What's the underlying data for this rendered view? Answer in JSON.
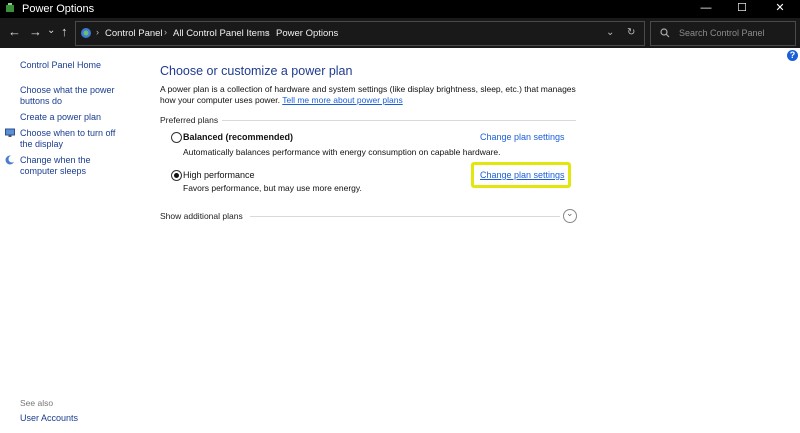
{
  "window": {
    "title": "Power Options",
    "minimize": "—",
    "maximize": "☐",
    "close": "✕"
  },
  "nav": {
    "back": "←",
    "forward": "→",
    "recent": "⌄",
    "up": "↑"
  },
  "address": {
    "crumbs": [
      "Control Panel",
      "All Control Panel Items",
      "Power Options"
    ],
    "separator": "›",
    "dropdown": "⌄",
    "refresh": "↻"
  },
  "search": {
    "placeholder": "Search Control Panel"
  },
  "help": "?",
  "sidebar": {
    "home": "Control Panel Home",
    "links": [
      "Choose what the power buttons do",
      "Create a power plan",
      "Choose when to turn off the display",
      "Change when the computer sleeps"
    ],
    "see_also": "See also",
    "user_accounts": "User Accounts"
  },
  "main": {
    "heading": "Choose or customize a power plan",
    "description": "A power plan is a collection of hardware and system settings (like display brightness, sleep, etc.) that manages how your computer uses power.",
    "tell_me_more": "Tell me more about power plans",
    "preferred_plans": "Preferred plans",
    "plans": [
      {
        "name": "Balanced (recommended)",
        "description": "Automatically balances performance with energy consumption on capable hardware.",
        "link": "Change plan settings",
        "selected": false
      },
      {
        "name": "High performance",
        "description": "Favors performance, but may use more energy.",
        "link": "Change plan settings",
        "selected": true
      }
    ],
    "show_additional": "Show additional plans",
    "expand_glyph": "⌄"
  },
  "colors": {
    "highlight": "#e2e60a",
    "link": "#1a5fd8",
    "heading": "#1e3b8f",
    "titlebar": "#000000"
  }
}
